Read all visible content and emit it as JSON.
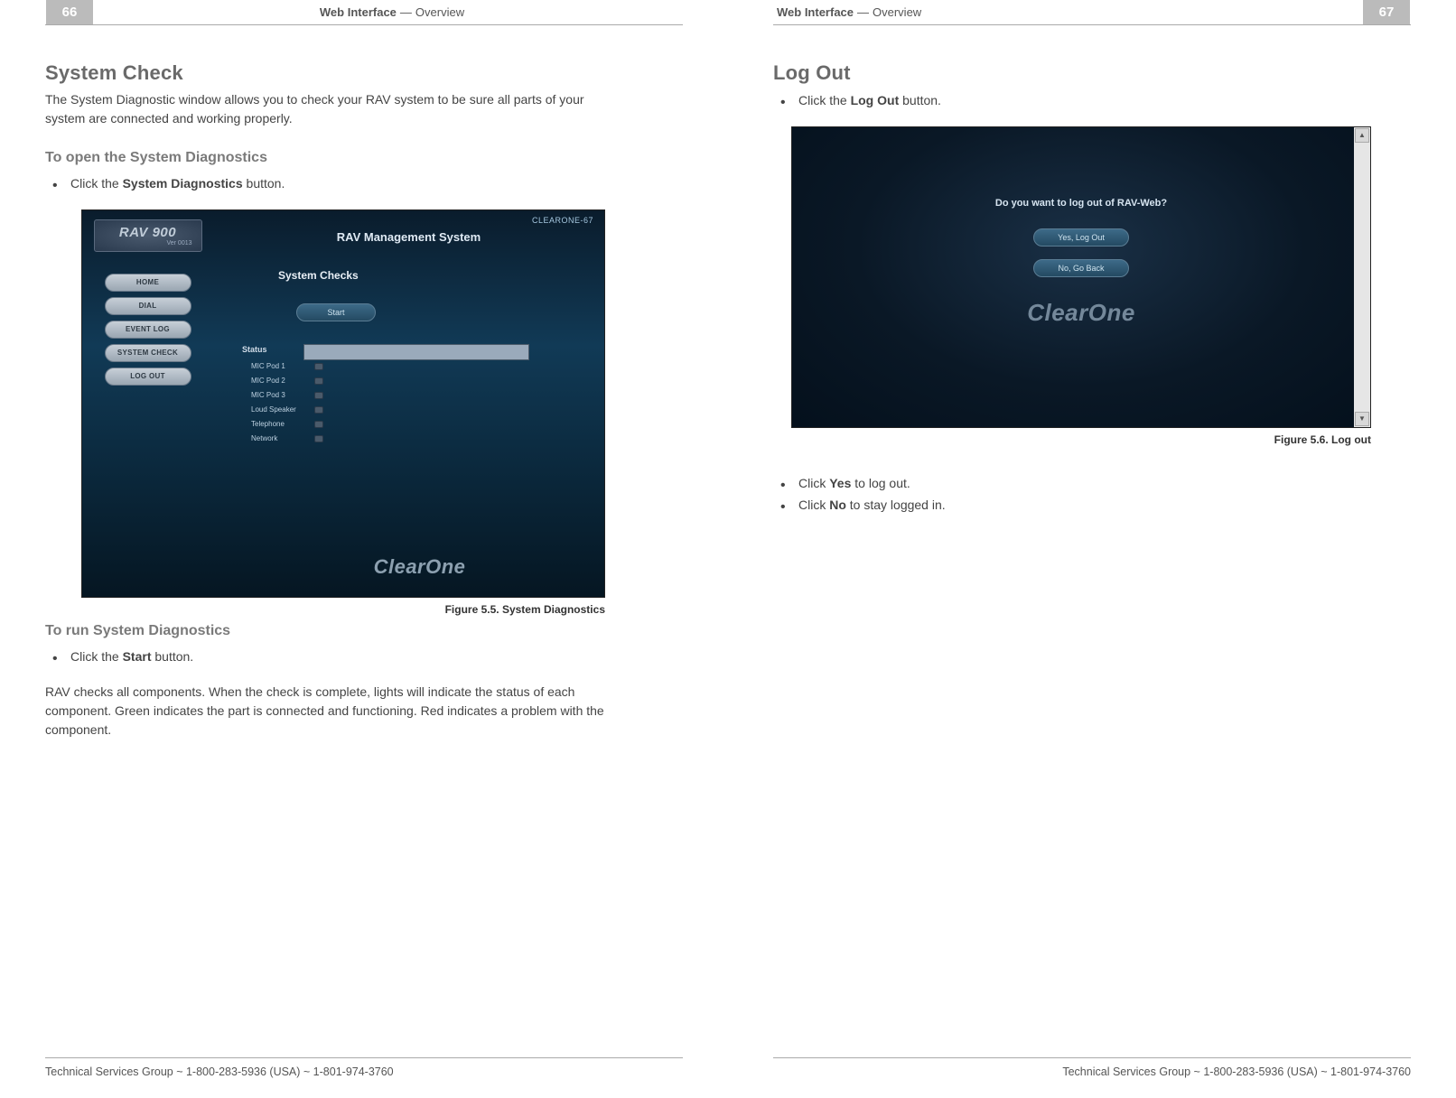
{
  "header": {
    "title_strong": "Web Interface",
    "title_sep": "—",
    "title_light": "Overview"
  },
  "left": {
    "page_num": "66",
    "h2": "System Check",
    "intro": "The System Diagnostic window allows you to check your RAV system to be sure all parts of your system are connected and working properly.",
    "h3_open": "To open the System Diagnostics",
    "open_pre": "Click the ",
    "open_bold": "System Diagnostics",
    "open_post": " button.",
    "fig_caption": "Figure 5.5. System Diagnostics",
    "h3_run": "To run System Diagnostics",
    "run_pre": "Click the ",
    "run_bold": "Start",
    "run_post": " button.",
    "run_body": "RAV checks all components. When the check is complete, lights will indicate the status of each component. Green indicates the part is connected and functioning. Red indicates a problem with the component.",
    "footer": "Technical Services Group ~ 1-800-283-5936 (USA) ~ 1-801-974-3760"
  },
  "right": {
    "page_num": "67",
    "h2": "Log Out",
    "b1_pre": "Click the ",
    "b1_bold": "Log Out",
    "b1_post": " button.",
    "fig_caption": "Figure 5.6. Log out",
    "b2_pre": "Click ",
    "b2_bold": "Yes",
    "b2_post": " to log out.",
    "b3_pre": "Click ",
    "b3_bold": "No",
    "b3_post": " to stay logged in.",
    "footer": "Technical Services Group ~ 1-800-283-5936 (USA) ~ 1-801-974-3760"
  },
  "rav": {
    "logo_big": "RAV 900",
    "logo_small": "Ver 0013",
    "device": "CLEARONE-67",
    "title": "RAV Management System",
    "checks_header": "System Checks",
    "start": "Start",
    "status_title": "Status",
    "nav": [
      "HOME",
      "DIAL",
      "EVENT LOG",
      "SYSTEM CHECK",
      "LOG OUT"
    ],
    "status_items": [
      "MIC Pod 1",
      "MIC Pod 2",
      "MIC Pod 3",
      "Loud Speaker",
      "Telephone",
      "Network"
    ],
    "brand": "ClearOne"
  },
  "logout": {
    "question": "Do you want to log out of RAV-Web?",
    "yes": "Yes, Log Out",
    "no": "No, Go Back",
    "brand": "ClearOne"
  }
}
